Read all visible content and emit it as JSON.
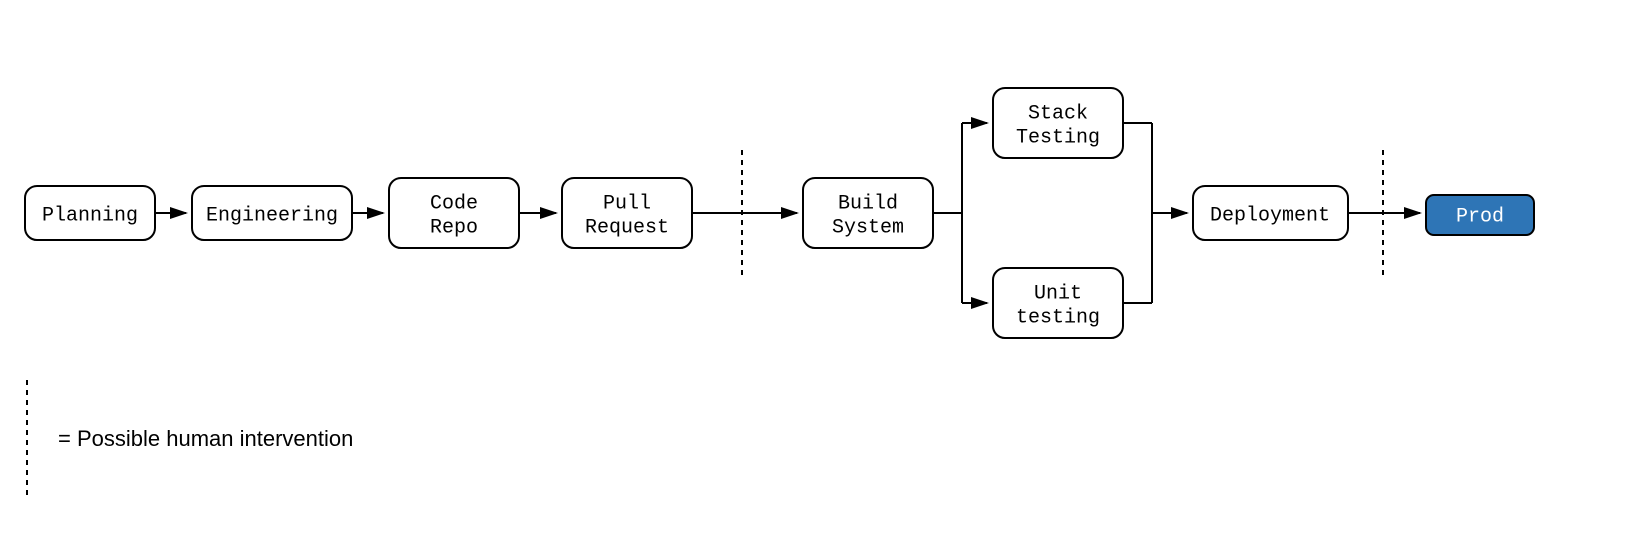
{
  "nodes": {
    "planning": {
      "label": "Planning"
    },
    "engineering": {
      "label": "Engineering"
    },
    "code_repo": {
      "line1": "Code",
      "line2": "Repo"
    },
    "pull_request": {
      "line1": "Pull",
      "line2": "Request"
    },
    "build_system": {
      "line1": "Build",
      "line2": "System"
    },
    "stack_testing": {
      "line1": "Stack",
      "line2": "Testing"
    },
    "unit_testing": {
      "line1": "Unit",
      "line2": "testing"
    },
    "deployment": {
      "label": "Deployment"
    },
    "prod": {
      "label": "Prod"
    }
  },
  "legend": {
    "text": "= Possible human intervention"
  },
  "colors": {
    "prod_fill": "#2e75b6",
    "stroke": "#000000",
    "bg": "#ffffff"
  }
}
